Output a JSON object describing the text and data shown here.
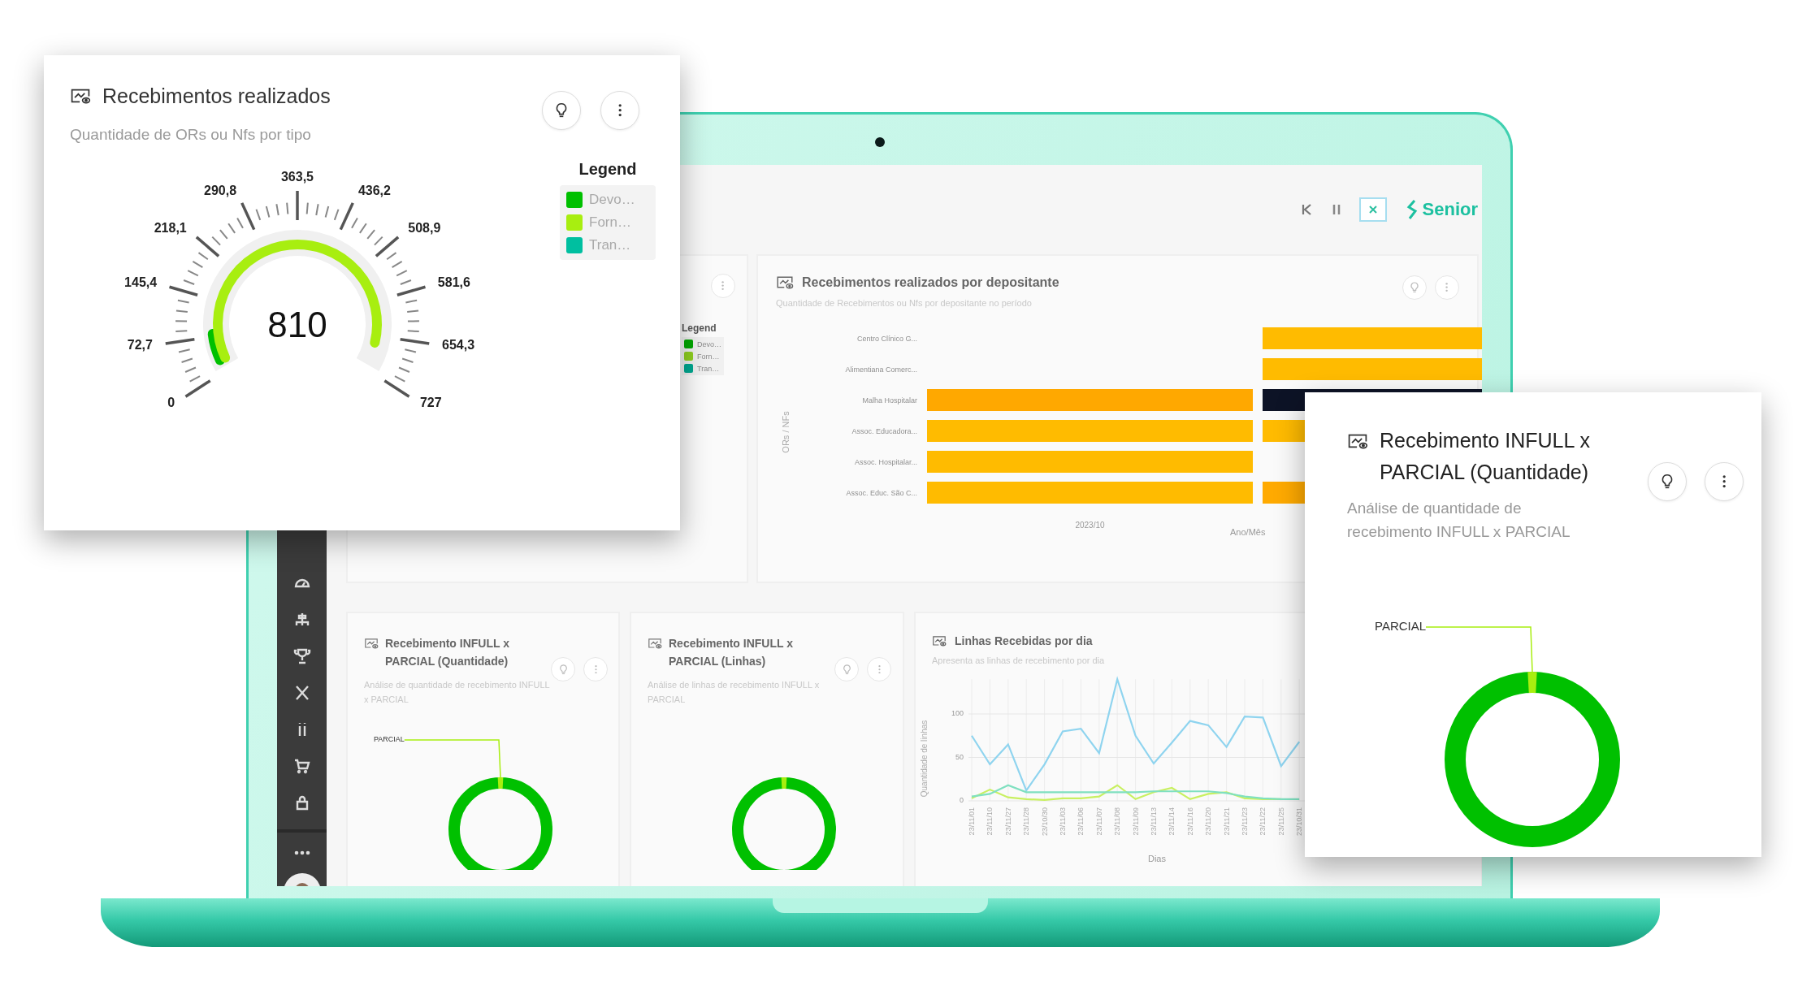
{
  "gauge_card": {
    "title": "Recebimentos realizados",
    "subtitle": "Quantidade de ORs ou Nfs por tipo",
    "gauge": {
      "value": "810",
      "tick_labels": [
        "0",
        "72,7",
        "145,4",
        "218,1",
        "290,8",
        "363,5",
        "436,2",
        "508,9",
        "581,6",
        "654,3",
        "727"
      ],
      "arcs": [
        {
          "color": "#00c000",
          "level": 0.08
        },
        {
          "color": "#a8ee10",
          "level": 0.95
        }
      ]
    },
    "legend": {
      "title": "Legend",
      "items": [
        {
          "label": "Devo…",
          "color": "#00c000"
        },
        {
          "label": "Forn…",
          "color": "#a8ee10"
        },
        {
          "label": "Tran…",
          "color": "#00bfa0"
        }
      ]
    }
  },
  "dashboard": {
    "header": {
      "brand": "Senior"
    },
    "legend_card": {
      "legend": {
        "title": "Legend",
        "items": [
          {
            "label": "Devo…",
            "color": "#00a800"
          },
          {
            "label": "Forn…",
            "color": "#8fcf20"
          },
          {
            "label": "Tran…",
            "color": "#00a890"
          }
        ]
      }
    },
    "bar_card": {
      "title": "Recebimentos realizados por depositante",
      "subtitle": "Quantidade de Recebimentos ou Nfs por depositante no período",
      "y_axis_label": "ORs / NFs",
      "rows": [
        {
          "label": "Centro Clínico G...",
          "bar_2": {
            "color": "#ffbb00"
          }
        },
        {
          "label": "Alimentiana Comerc...",
          "bar_2": {
            "color": "#ffbb00"
          }
        },
        {
          "label": "Malha Hospitalar",
          "bar_1": {
            "color": "#ffa800"
          },
          "bar_2": {
            "color": "#0d1326"
          }
        },
        {
          "label": "Assoc. Educadora...",
          "bar_1": {
            "color": "#ffbb00"
          },
          "bar_2": {
            "color": "#ffbb00"
          }
        },
        {
          "label": "Assoc. Hospitalar...",
          "bar_1": {
            "color": "#ffbb00"
          }
        },
        {
          "label": "Assoc. Educ. São C...",
          "bar_1": {
            "color": "#ffbb00"
          },
          "bar_2": {
            "color": "#ffaa00"
          }
        }
      ],
      "x_label": "2023/10",
      "x_axis_label": "Ano/Mês"
    },
    "donut_cards": [
      {
        "title": "Recebimento INFULL x PARCIAL (Quantidade)",
        "subtitle": "Análise de quantidade de recebimento INFULL x PARCIAL",
        "callout": "PARCIAL"
      },
      {
        "title": "Recebimento INFULL x PARCIAL (Linhas)",
        "subtitle": "Análise de linhas de recebimento INFULL x PARCIAL"
      }
    ],
    "line_card": {
      "title": "Linhas Recebidas por dia",
      "subtitle": "Apresenta as linhas de recebimento por dia",
      "chart_data": {
        "type": "line",
        "xlabel": "Dias",
        "ylabel": "Quantidade de linhas",
        "categories": [
          "23/11/01",
          "23/11/10",
          "23/11/27",
          "23/11/28",
          "23/10/30",
          "23/11/03",
          "23/11/06",
          "23/11/07",
          "23/11/08",
          "23/11/09",
          "23/11/13",
          "23/11/14",
          "23/11/16",
          "23/11/20",
          "23/11/21",
          "23/11/23",
          "23/11/22",
          "23/11/25",
          "23/10/31"
        ],
        "grid": true,
        "ylim": [
          0,
          140
        ],
        "yticks": [
          {
            "value": 0,
            "label": "0"
          },
          {
            "value": 50,
            "label": "50"
          },
          {
            "value": 100,
            "label": "100"
          }
        ],
        "series": [
          {
            "color": "#8fd4ef",
            "values": [
              75,
              42,
              65,
              12,
              42,
              80,
              83,
              55,
              140,
              75,
              43,
              67,
              92,
              87,
              62,
              97,
              96,
              40,
              68
            ]
          },
          {
            "color": "#c8f060",
            "values": [
              3,
              13,
              4,
              2,
              1,
              3,
              3,
              5,
              18,
              2,
              10,
              15,
              2,
              8,
              10,
              3,
              2,
              2,
              null
            ]
          },
          {
            "color": "#7fe0c0",
            "values": [
              5,
              8,
              18,
              10,
              10,
              10,
              10,
              10,
              10,
              10,
              11,
              11,
              11,
              11,
              9,
              5,
              3,
              2,
              2
            ]
          }
        ]
      }
    }
  },
  "donut_card": {
    "title": "Recebimento INFULL x PARCIAL (Quantidade)",
    "subtitle": "Análise de quantidade de recebimento INFULL x PARCIAL",
    "callout": "PARCIAL"
  }
}
